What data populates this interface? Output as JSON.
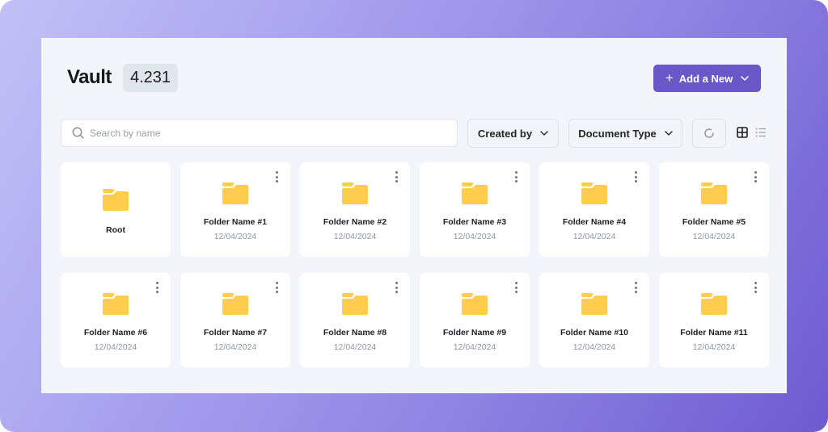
{
  "header": {
    "title": "Vault",
    "count": "4.231",
    "add_button_label": "Add a New"
  },
  "toolbar": {
    "search_placeholder": "Search by name",
    "search_value": "",
    "filters": [
      {
        "label": "Created by"
      },
      {
        "label": "Document Type"
      }
    ],
    "view_mode": "grid"
  },
  "colors": {
    "accent": "#6a58c8",
    "folder": "#ffcc4d",
    "panel_bg": "#f4f5fa"
  },
  "folders": [
    {
      "name": "Root",
      "date": ""
    },
    {
      "name": "Folder Name #1",
      "date": "12/04/2024"
    },
    {
      "name": "Folder Name #2",
      "date": "12/04/2024"
    },
    {
      "name": "Folder Name #3",
      "date": "12/04/2024"
    },
    {
      "name": "Folder Name #4",
      "date": "12/04/2024"
    },
    {
      "name": "Folder Name #5",
      "date": "12/04/2024"
    },
    {
      "name": "Folder Name #6",
      "date": "12/04/2024"
    },
    {
      "name": "Folder Name #7",
      "date": "12/04/2024"
    },
    {
      "name": "Folder Name #8",
      "date": "12/04/2024"
    },
    {
      "name": "Folder Name #9",
      "date": "12/04/2024"
    },
    {
      "name": "Folder Name #10",
      "date": "12/04/2024"
    },
    {
      "name": "Folder Name #11",
      "date": "12/04/2024"
    }
  ]
}
